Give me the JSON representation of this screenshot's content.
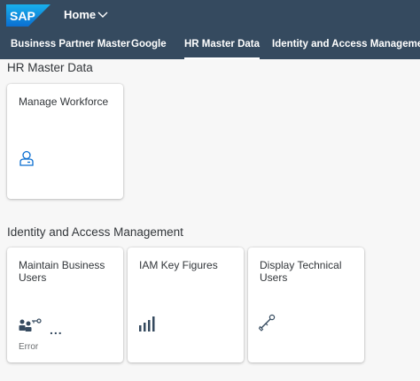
{
  "shell": {
    "logo_text": "SAP",
    "title": "Home",
    "brand_color": "#354a5f"
  },
  "tabs": [
    {
      "label": "Business Partner Master"
    },
    {
      "label": "Google"
    },
    {
      "label": "HR Master Data",
      "active": true
    },
    {
      "label": "Identity and Access Management"
    }
  ],
  "sections": [
    {
      "title": "HR Master Data",
      "tiles": [
        {
          "title": "Manage Workforce",
          "icon": "person-icon",
          "footer": ""
        }
      ]
    },
    {
      "title": "Identity and Access Management",
      "tiles": [
        {
          "title": "Maintain Business Users",
          "icon": "users-key-icon",
          "more": "...",
          "footer": "Error"
        },
        {
          "title": "IAM Key Figures",
          "icon": "bar-chart-icon",
          "footer": ""
        },
        {
          "title": "Display Technical Users",
          "icon": "wrench-key-icon",
          "footer": ""
        }
      ]
    }
  ]
}
